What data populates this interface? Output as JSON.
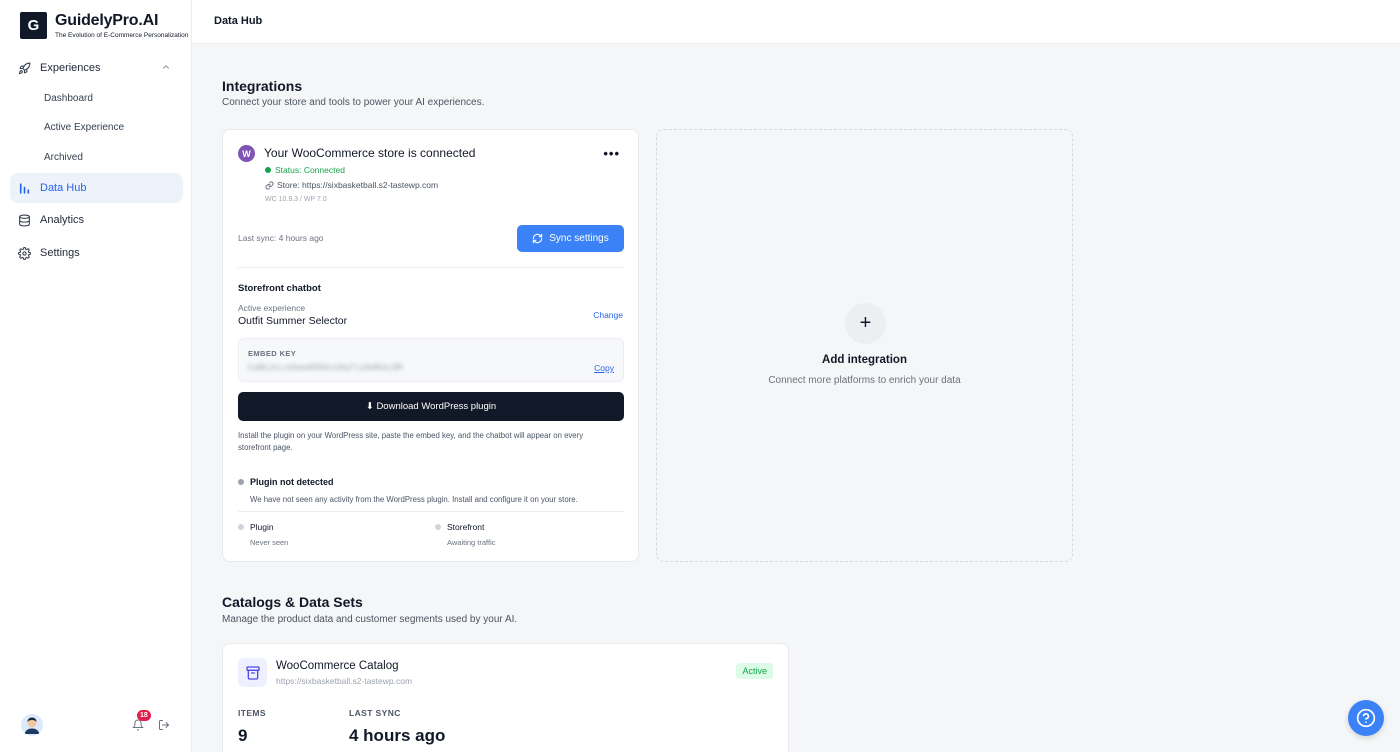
{
  "brand": {
    "logo_letter": "G",
    "name": "GuidelyPro.AI",
    "tagline": "The Evolution of E-Commerce Personalization"
  },
  "sidebar": {
    "groups": [
      {
        "label": "Experiences",
        "icon": "rocket-icon",
        "expanded": true
      },
      {
        "label": "Data Hub",
        "icon": "bar-chart-icon",
        "active": true
      },
      {
        "label": "Analytics",
        "icon": "database-icon"
      },
      {
        "label": "Settings",
        "icon": "gear-icon"
      }
    ],
    "sub_items": [
      "Dashboard",
      "Active Experience",
      "Archived"
    ],
    "notification_count": "18"
  },
  "topbar": {
    "title": "Data Hub"
  },
  "integrations": {
    "title": "Integrations",
    "subtitle": "Connect your store and tools to power your AI experiences.",
    "card": {
      "logo_letter": "W",
      "title": "Your WooCommerce store is connected",
      "more": "•••",
      "status": "Status: Connected",
      "store": "Store: https://sixbasketball.s2-tastewp.com",
      "version": "WC 10.9.3 / WP 7.0",
      "last_sync": "Last sync: 4 hours ago",
      "sync_button": "Sync settings",
      "chatbot_title": "Storefront chatbot",
      "active_experience_label": "Active experience",
      "active_experience_value": "Outfit Summer Selector",
      "change_link": "Change",
      "embed_key_label": "EMBED KEY",
      "embed_key_value": "Ea8KjmiceHemdK86bvG0q7lxHeNhbcDM",
      "copy_link": "Copy",
      "download_button": "⬇ Download WordPress plugin",
      "install_help": "Install the plugin on your WordPress site, paste the embed key, and the chatbot will appear on every storefront page.",
      "plugin_status_title": "Plugin not detected",
      "plugin_status_desc": "We have not seen any activity from the WordPress plugin. Install and configure it on your store.",
      "plugin_label": "Plugin",
      "plugin_sub": "Never seen",
      "storefront_label": "Storefront",
      "storefront_sub": "Awaiting traffic"
    },
    "add": {
      "plus": "+",
      "title": "Add integration",
      "subtitle": "Connect more platforms to enrich your data"
    }
  },
  "catalogs": {
    "title": "Catalogs & Data Sets",
    "subtitle": "Manage the product data and customer segments used by your AI.",
    "card": {
      "name": "WooCommerce Catalog",
      "url": "https://sixbasketball.s2-tastewp.com",
      "badge": "Active",
      "items_label": "ITEMS",
      "items_value": "9",
      "last_sync_label": "LAST SYNC",
      "last_sync_value": "4 hours ago"
    }
  },
  "colors": {
    "accent": "#3b82f6",
    "active_nav_bg": "#eef2fb",
    "success": "#16a34a",
    "dark_button": "#111827",
    "woo_purple": "#7f54b3"
  }
}
